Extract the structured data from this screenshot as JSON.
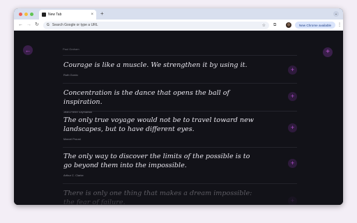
{
  "browser": {
    "tab_title": "New Tab",
    "tab_close": "×",
    "new_tab": "+",
    "omnibox_placeholder": "Search Google or type a URL",
    "omnibox_icon": "G",
    "update_label": "New Chrome available",
    "update_menu": "⋮"
  },
  "page": {
    "top_author": "Paul Graham",
    "back_icon": "←",
    "add_icon": "+",
    "quotes": [
      {
        "text": "Courage is like a muscle. We strengthen it by using it.",
        "author": "Ruth Gordo"
      },
      {
        "text": "Concentration is the dance that opens the ball of inspiration.",
        "author": "Jean-Pierre Szymanski"
      },
      {
        "text": "The only true voyage would not be to travel toward new landscapes, but to have different eyes.",
        "author": "Marcel Proust"
      },
      {
        "text": "The only way to discover the limits of the possible is to go beyond them into the impossible.",
        "author": "Arthur C. Clarke"
      },
      {
        "text": "There is only one thing that makes a dream impossible: the fear of failure.",
        "author": ""
      }
    ]
  },
  "colors": {
    "background": "#121218",
    "accent": "#c25ad9",
    "accent_bg": "#3a1f4a"
  }
}
